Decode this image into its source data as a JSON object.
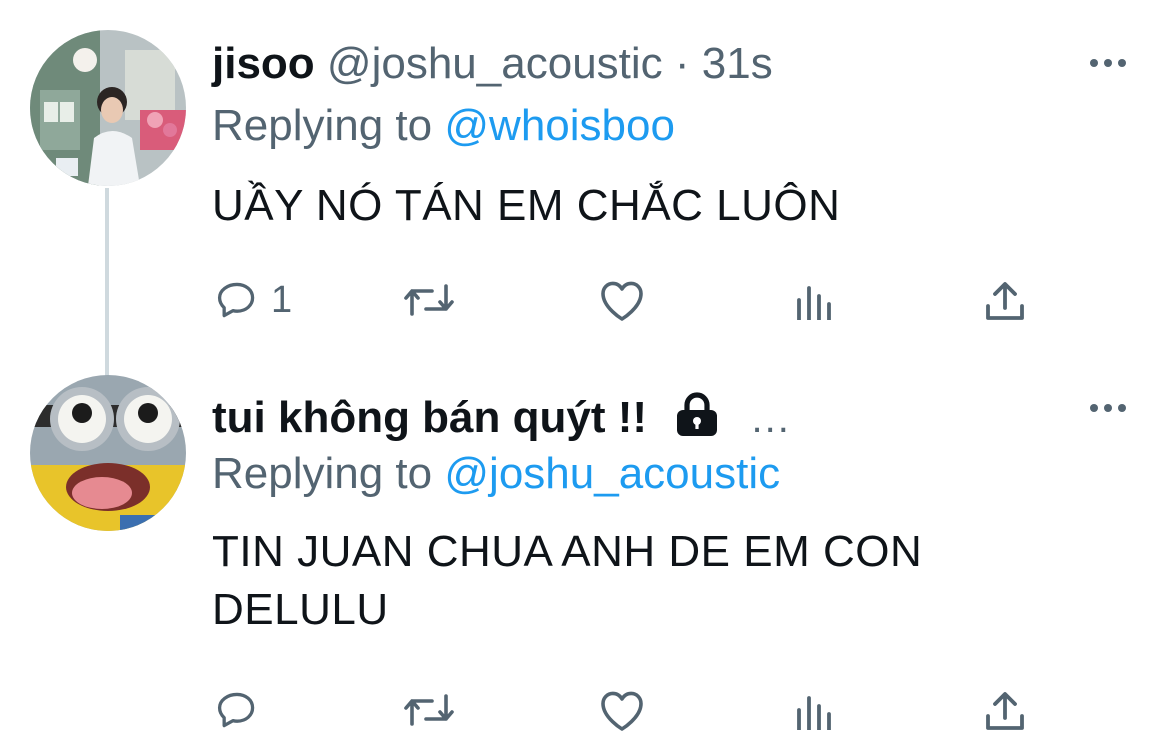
{
  "tweets": [
    {
      "display_name": "jisoo",
      "handle": "@joshu_acoustic",
      "separator": "·",
      "time": "31s",
      "replying_prefix": "Replying to",
      "replying_to": "@whoisboo",
      "text": "UẦY NÓ TÁN EM CHẮC LUÔN",
      "reply_count": "1",
      "avatar": "photo-of-young-man-outdoors"
    },
    {
      "display_name": "tui không bán quýt !!",
      "protected_icon": "lock-icon",
      "truncation": "...",
      "replying_prefix": "Replying to",
      "replying_to": "@joshu_acoustic",
      "text_line1": "TIN JUAN CHUA ANH DE EM CON",
      "text_line2": "DELULU",
      "avatar": "minion-cartoon"
    }
  ],
  "actions": [
    "reply-icon",
    "retweet-icon",
    "like-icon",
    "analytics-icon",
    "share-icon"
  ],
  "colors": {
    "text": "#0f1419",
    "secondary": "#536471",
    "link": "#1d9bf0",
    "thread_line": "#cfd9de"
  }
}
